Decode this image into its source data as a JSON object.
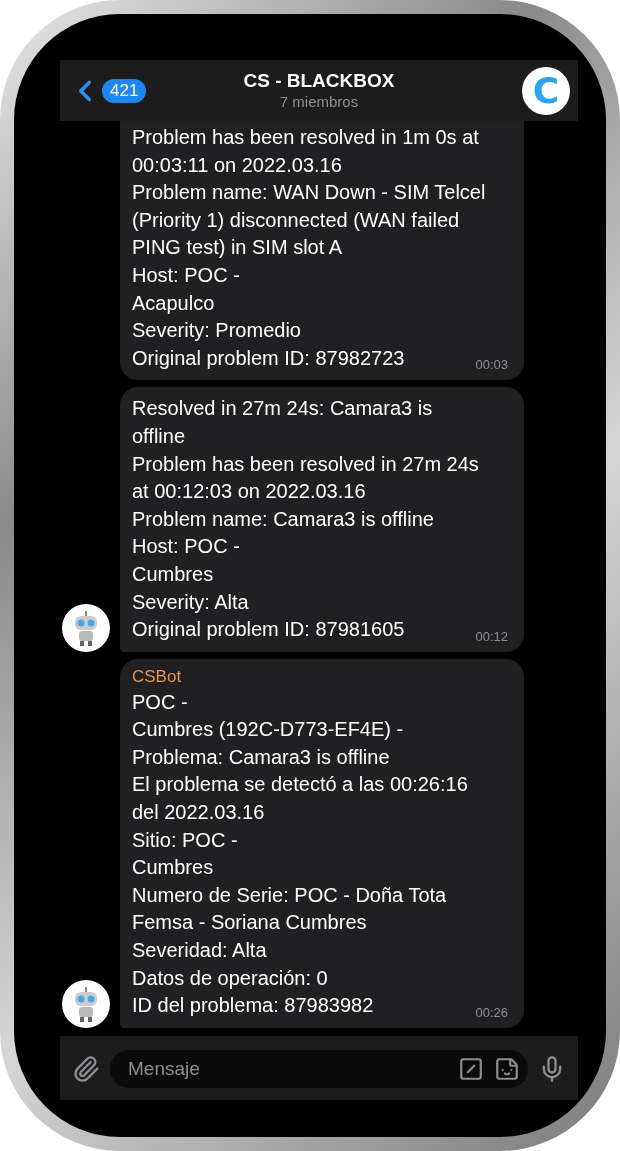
{
  "header": {
    "back_count": "421",
    "title": "CS - BLACKBOX",
    "subtitle": "7 miembros",
    "avatar_letter": "C"
  },
  "messages": [
    {
      "show_avatar": false,
      "continued": true,
      "lines": [
        "Problem has been resolved in 1m 0s at",
        "00:03:11 on 2022.03.16",
        "Problem name: WAN Down - SIM Telcel",
        "(Priority 1) disconnected (WAN failed",
        "PING test) in SIM slot A",
        "Host: POC -",
        "Acapulco",
        "Severity: Promedio",
        "Original problem ID: 87982723"
      ],
      "time": "00:03"
    },
    {
      "show_avatar": true,
      "continued": false,
      "lines": [
        "Resolved in 27m 24s: Camara3 is",
        "offline",
        "Problem has been resolved in 27m 24s",
        "at 00:12:03 on 2022.03.16",
        "Problem name: Camara3 is offline",
        "Host: POC -",
        "Cumbres",
        "Severity: Alta",
        "Original problem ID: 87981605"
      ],
      "time": "00:12"
    },
    {
      "sender": "CSBot",
      "show_avatar": true,
      "continued": false,
      "lines": [
        "POC -",
        "Cumbres (192C-D773-EF4E) -",
        "Problema: Camara3 is offline",
        "El problema se detectó a las 00:26:16",
        "del 2022.03.16",
        "Sitio: POC -",
        "Cumbres",
        "Numero de Serie: POC - Doña Tota",
        "Femsa - Soriana Cumbres",
        "Severidad: Alta",
        "Datos de operación: 0",
        "ID del problema: 87983982"
      ],
      "time": "00:26"
    }
  ],
  "composer": {
    "placeholder": "Mensaje"
  }
}
